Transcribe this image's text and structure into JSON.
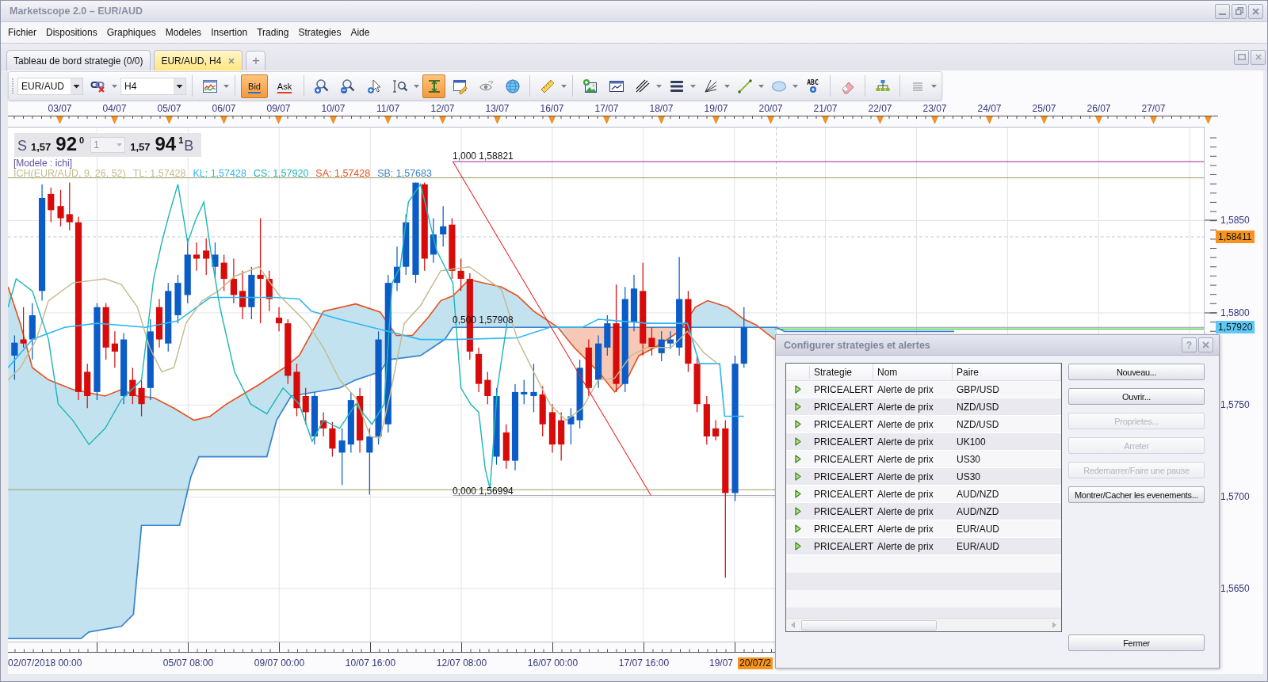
{
  "window": {
    "title": "Marketscope 2.0 – EUR/AUD"
  },
  "menu": [
    "Fichier",
    "Dispositions",
    "Graphiques",
    "Modeles",
    "Insertion",
    "Trading",
    "Strategies",
    "Aide"
  ],
  "tabs": [
    {
      "label": "Tableau de bord strategie (0/0)",
      "selected": false,
      "closable": false
    },
    {
      "label": "EUR/AUD, H4",
      "selected": true,
      "closable": true
    }
  ],
  "new_tab": "+",
  "toolbar": {
    "groups": [
      [
        {
          "kind": "combo",
          "value": "EUR/AUD"
        },
        {
          "kind": "link-cross",
          "menu": true,
          "selected": false
        },
        {
          "kind": "combo",
          "value": "H4"
        }
      ],
      [
        {
          "kind": "zigzag-chart",
          "menu": true,
          "selected": false
        }
      ],
      [
        {
          "kind": "bid",
          "label": "Bid",
          "selected": true
        },
        {
          "kind": "ask",
          "label": "Ask",
          "selected": false
        }
      ],
      [
        {
          "kind": "zoom-in",
          "menu": false,
          "selected": false
        },
        {
          "kind": "zoom-out",
          "menu": false,
          "selected": false
        },
        {
          "kind": "zoom-cursor",
          "menu": false,
          "selected": false
        },
        {
          "kind": "zoom-range",
          "menu": true,
          "selected": false
        },
        {
          "kind": "vertical-span",
          "menu": false,
          "selected": true
        },
        {
          "kind": "window-pencil",
          "menu": false,
          "selected": false
        },
        {
          "kind": "eye",
          "menu": false,
          "selected": false
        },
        {
          "kind": "globe",
          "menu": false,
          "selected": false
        }
      ],
      [
        {
          "kind": "ruler",
          "menu": true,
          "selected": false
        }
      ],
      [
        {
          "kind": "picture",
          "menu": false,
          "selected": false
        },
        {
          "kind": "chart-window",
          "menu": false,
          "selected": false
        },
        {
          "kind": "parallel-lines",
          "menu": true,
          "selected": false
        },
        {
          "kind": "horizontal-lines",
          "menu": true,
          "selected": false
        },
        {
          "kind": "fan-lines",
          "menu": true,
          "selected": false
        },
        {
          "kind": "line-segment",
          "menu": true,
          "selected": false
        },
        {
          "kind": "ellipse",
          "menu": true,
          "selected": false
        },
        {
          "kind": "text-tool",
          "label": "ABC",
          "menu": false,
          "selected": false
        }
      ],
      [
        {
          "kind": "eraser",
          "menu": false,
          "selected": false
        }
      ],
      [
        {
          "kind": "hierarchy",
          "menu": false,
          "selected": false
        }
      ],
      [
        {
          "kind": "overflow",
          "menu": true,
          "selected": false
        }
      ]
    ]
  },
  "date_axis": [
    "03/07",
    "04/07",
    "05/07",
    "06/07",
    "09/07",
    "10/07",
    "11/07",
    "12/07",
    "13/07",
    "16/07",
    "17/07",
    "18/07",
    "19/07",
    "20/07",
    "21/07",
    "22/07",
    "23/07",
    "24/07",
    "25/07",
    "26/07",
    "27/07"
  ],
  "chart": {
    "quote": {
      "sell_label": "S",
      "sell_prefix": "1,57",
      "sell_digits": "92",
      "sell_fraction": "0",
      "amount": {
        "value": "1",
        "disabled": true
      },
      "buy_prefix": "1,57",
      "buy_digits": "94",
      "buy_fraction": "1",
      "buy_label": "B"
    },
    "model": "[Modele : ichi]",
    "indicators": [
      {
        "text": "ICH(EUR/AUD, 9, 26, 52)",
        "color": "#c4ba8c"
      },
      {
        "text": "TL: 1,57428",
        "color": "#c4ba8c"
      },
      {
        "text": "KL: 1,57428",
        "color": "#2fb6f2"
      },
      {
        "text": "CS: 1,57920",
        "color": "#1fb7b7"
      },
      {
        "text": "SA: 1,57428",
        "color": "#e8501c"
      },
      {
        "text": "SB: 1,57683",
        "color": "#3a84cf"
      }
    ],
    "fib_levels": [
      "1,000 1,58821",
      "0,500 1,57908",
      "0,000 1,56994"
    ]
  },
  "price_axis": {
    "labels": [
      "1,5850",
      "1,5800",
      "1,5750",
      "1,5700",
      "1,5650"
    ],
    "markers": [
      {
        "text": "1,58411",
        "color": "#f7941d"
      },
      {
        "text": "1,57920",
        "color": "#5ec9f6"
      }
    ]
  },
  "time_axis": {
    "labels": [
      "02/07/2018 00:00",
      "05/07 08:00",
      "09/07 00:00",
      "10/07 16:00",
      "12/07 08:00",
      "16/07 00:00",
      "17/07 16:00",
      "19/07"
    ],
    "current": "20/07/2"
  },
  "dialog": {
    "title": "Configurer strategies et alertes",
    "help_label": "?",
    "columns": [
      "Strategie",
      "Nom",
      "Paire"
    ],
    "rows": [
      {
        "strategy": "PRICEALERT",
        "name": "Alerte de prix",
        "pair": "GBP/USD",
        "running": true
      },
      {
        "strategy": "PRICEALERT",
        "name": "Alerte de prix",
        "pair": "NZD/USD",
        "running": true
      },
      {
        "strategy": "PRICEALERT",
        "name": "Alerte de prix",
        "pair": "NZD/USD",
        "running": true
      },
      {
        "strategy": "PRICEALERT",
        "name": "Alerte de prix",
        "pair": "UK100",
        "running": true
      },
      {
        "strategy": "PRICEALERT",
        "name": "Alerte de prix",
        "pair": "US30",
        "running": true
      },
      {
        "strategy": "PRICEALERT",
        "name": "Alerte de prix",
        "pair": "US30",
        "running": true
      },
      {
        "strategy": "PRICEALERT",
        "name": "Alerte de prix",
        "pair": "AUD/NZD",
        "running": true
      },
      {
        "strategy": "PRICEALERT",
        "name": "Alerte de prix",
        "pair": "AUD/NZD",
        "running": true
      },
      {
        "strategy": "PRICEALERT",
        "name": "Alerte de prix",
        "pair": "EUR/AUD",
        "running": true
      },
      {
        "strategy": "PRICEALERT",
        "name": "Alerte de prix",
        "pair": "EUR/AUD",
        "running": true
      }
    ],
    "actions": [
      {
        "label": "Nouveau...",
        "disabled": false
      },
      {
        "label": "Ouvrir...",
        "disabled": false
      },
      {
        "label": "Proprietes...",
        "disabled": true
      },
      {
        "label": "Arreter",
        "disabled": true
      },
      {
        "label": "Redemarrer/Faire une pause",
        "disabled": true
      },
      {
        "label": "Montrer/Cacher les evenements...",
        "disabled": false
      }
    ],
    "close_label": "Fermer"
  }
}
